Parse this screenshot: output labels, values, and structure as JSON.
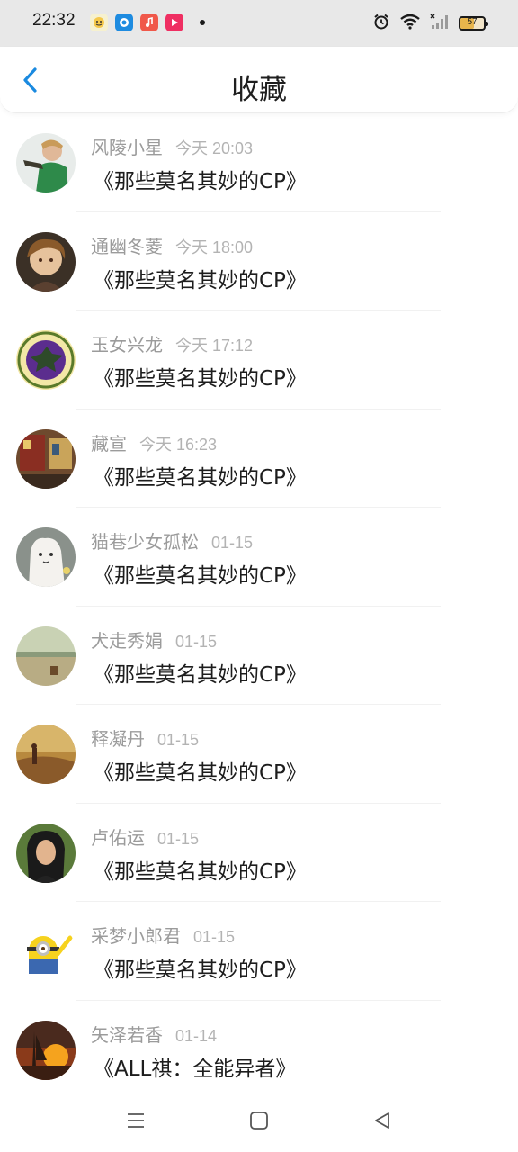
{
  "status_bar": {
    "time": "22:32",
    "apps": [
      "notification-app-1-icon",
      "notification-app-2-icon",
      "music-app-icon",
      "video-app-icon"
    ],
    "battery": "57",
    "battery_level": 0.57,
    "icons": [
      "alarm-icon",
      "wifi-icon",
      "cellular-signal-icon",
      "battery-icon"
    ]
  },
  "header": {
    "title": "收藏",
    "back_icon": "chevron-left-icon",
    "accent_color": "#1a8ae0"
  },
  "favorites": [
    {
      "user": "风陵小星",
      "time": "今天 20:03",
      "title": "《那些莫名其妙的CP》"
    },
    {
      "user": "通幽冬菱",
      "time": "今天 18:00",
      "title": "《那些莫名其妙的CP》"
    },
    {
      "user": "玉女兴龙",
      "time": "今天 17:12",
      "title": "《那些莫名其妙的CP》"
    },
    {
      "user": "藏宣",
      "time": "今天 16:23",
      "title": "《那些莫名其妙的CP》"
    },
    {
      "user": "猫巷少女孤松",
      "time": "01-15",
      "title": "《那些莫名其妙的CP》"
    },
    {
      "user": "犬走秀娟",
      "time": "01-15",
      "title": "《那些莫名其妙的CP》"
    },
    {
      "user": "释凝丹",
      "time": "01-15",
      "title": "《那些莫名其妙的CP》"
    },
    {
      "user": "卢佑运",
      "time": "01-15",
      "title": "《那些莫名其妙的CP》"
    },
    {
      "user": "采梦小郎君",
      "time": "01-15",
      "title": "《那些莫名其妙的CP》"
    },
    {
      "user": "矢泽若香",
      "time": "01-14",
      "title": "《ALL祺：全能异者》"
    }
  ],
  "nav_bar": {
    "icons": [
      "menu-icon",
      "home-square-icon",
      "back-triangle-icon"
    ]
  }
}
